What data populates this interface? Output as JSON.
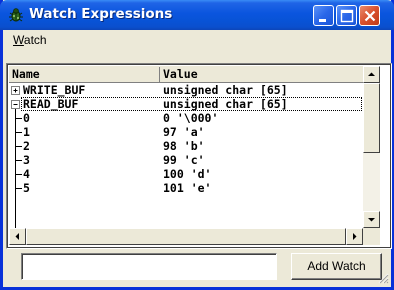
{
  "window": {
    "title": "Watch Expressions",
    "app_icon": "bug-icon"
  },
  "menu": {
    "watch_label": "Watch",
    "watch_mnemonic": "W",
    "watch_rest": "atch"
  },
  "table": {
    "columns": {
      "name": "Name",
      "value": "Value"
    },
    "rows": [
      {
        "name": "WRITE_BUF",
        "value": "unsigned char [65]",
        "expander": "plus"
      },
      {
        "name": "READ_BUF",
        "value": "unsigned char [65]",
        "expander": "minus",
        "selected": true
      },
      {
        "name": "0",
        "value": "0 '\\000'"
      },
      {
        "name": "1",
        "value": "97 'a'"
      },
      {
        "name": "2",
        "value": "98 'b'"
      },
      {
        "name": "3",
        "value": "99 'c'"
      },
      {
        "name": "4",
        "value": "100 'd'"
      },
      {
        "name": "5",
        "value": "101 'e'"
      }
    ]
  },
  "input": {
    "value": "",
    "placeholder": ""
  },
  "add_watch_label": "Add Watch",
  "colors": {
    "title_blue": "#0a55de",
    "face": "#ece9d8",
    "close_red": "#d8502d"
  }
}
